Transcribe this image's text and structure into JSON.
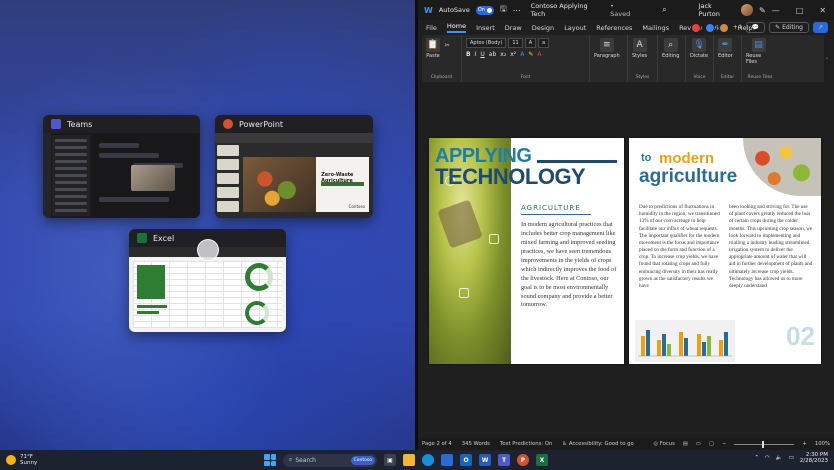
{
  "snap_assist": {
    "cards": [
      {
        "app": "Teams",
        "icon": "teams-icon",
        "color": "#5059c9"
      },
      {
        "app": "PowerPoint",
        "icon": "powerpoint-icon",
        "color": "#d35230",
        "slide_title": "Zero-Waste Agriculture",
        "slide_brand": "Contoso"
      },
      {
        "app": "Excel",
        "icon": "excel-icon",
        "color": "#1d6f42"
      }
    ]
  },
  "word": {
    "titlebar": {
      "autosave_label": "AutoSave",
      "autosave_state": "On",
      "doc_title": "Contoso Applying Tech",
      "saved_status": "• Saved",
      "user_name": "Jack Purton",
      "minimize": "—",
      "maximize": "□",
      "close": "✕"
    },
    "menu": [
      "File",
      "Home",
      "Insert",
      "Draw",
      "Design",
      "Layout",
      "References",
      "Mailings",
      "Review",
      "View",
      "Help"
    ],
    "active_menu": "Home",
    "collab": {
      "extra_count": "+4",
      "editing_label": "Editing"
    },
    "ribbon": {
      "clipboard": {
        "paste": "Paste",
        "label": "Clipboard"
      },
      "font": {
        "name": "Aptos (Body)",
        "size": "11",
        "bold": "B",
        "italic": "I",
        "underline": "U",
        "label": "Font"
      },
      "paragraph": {
        "button": "Paragraph"
      },
      "styles": {
        "button": "Styles",
        "label": "Styles"
      },
      "editing": {
        "button": "Editing"
      },
      "voice": {
        "button": "Dictate",
        "label": "Voice"
      },
      "editor": {
        "button": "Editor",
        "label": "Editor"
      },
      "reuse": {
        "button": "Reuse Files",
        "label": "Reuse Files"
      }
    },
    "page_left": {
      "heading_line1": "APPLYING",
      "heading_line2": "TECHNOLOGY",
      "kicker": "AGRICULTURE",
      "body": "In modern agricultural practices that includes better crop management like mixed farming and improved seeding practices, we have seen tremendous improvements in the yields of crops which indirectly improves the food of the livestock. Here at Contoso, our goal is to be most environmentally sound company and provide a better tomorrow."
    },
    "page_right": {
      "to": "to",
      "modern": "modern",
      "agriculture": "agriculture",
      "col1": "Due to predictions of fluctuations in humidity in the region, we transitioned 13% of our corn acreage to help facilitate our influx of wheat requests. The important qualifier for the modern movement is the focus and importance placed on the form and function of a crop. To increase crop yields, we have found that rotating crops and fully embracing diversity in their has really grown as the satisfactory results we have",
      "col2": "been looking and striving for. The use of plant covers greatly reduced the loss of certain crops during the colder months. This upcoming crop season, we look forward to implementing and trialling a industry leading streamlined irrigation system to deliver the appropriate amount of water that will aid in further development of plants and ultimately increase crop yields. Technology has allowed us to more deeply understand",
      "page_number": "02"
    },
    "statusbar": {
      "page": "Page 2 of 4",
      "words": "345 Words",
      "predictions": "Text Predictions: On",
      "accessibility": "Accessibility: Good to go",
      "focus": "Focus",
      "zoom": "100%"
    }
  },
  "taskbar": {
    "weather_temp": "71°F",
    "weather_desc": "Sunny",
    "search_placeholder": "Search",
    "search_tag": "Contoso",
    "time": "2:30 PM",
    "date": "2/28/2023"
  }
}
